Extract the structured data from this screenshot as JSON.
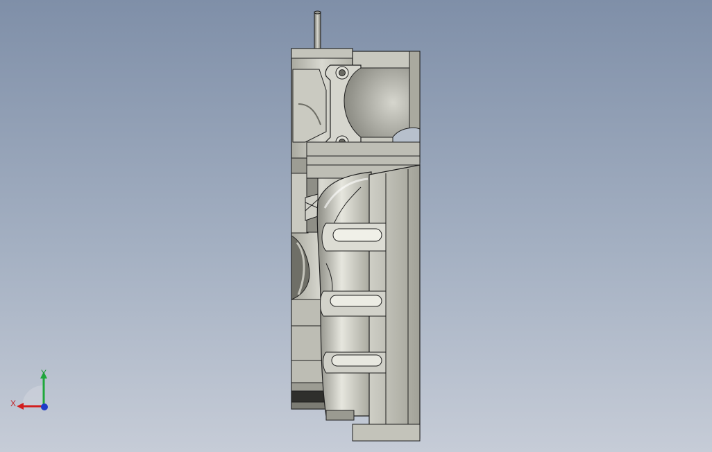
{
  "viewport": {
    "background_top": "#7f8fa8",
    "background_bottom": "#c6ccd7",
    "model": {
      "description_icon": "cad-part-side-view",
      "colors": {
        "light": "#d8d8d0",
        "mid": "#b6b6ac",
        "shade": "#8e8e86",
        "dark": "#4a4a46",
        "edge": "#1e1e1e"
      }
    }
  },
  "triad": {
    "x_label": "X",
    "y_label": "Y",
    "x_color": "#d21e1e",
    "y_color": "#1fa83c",
    "z_color": "#1e3cc8"
  }
}
